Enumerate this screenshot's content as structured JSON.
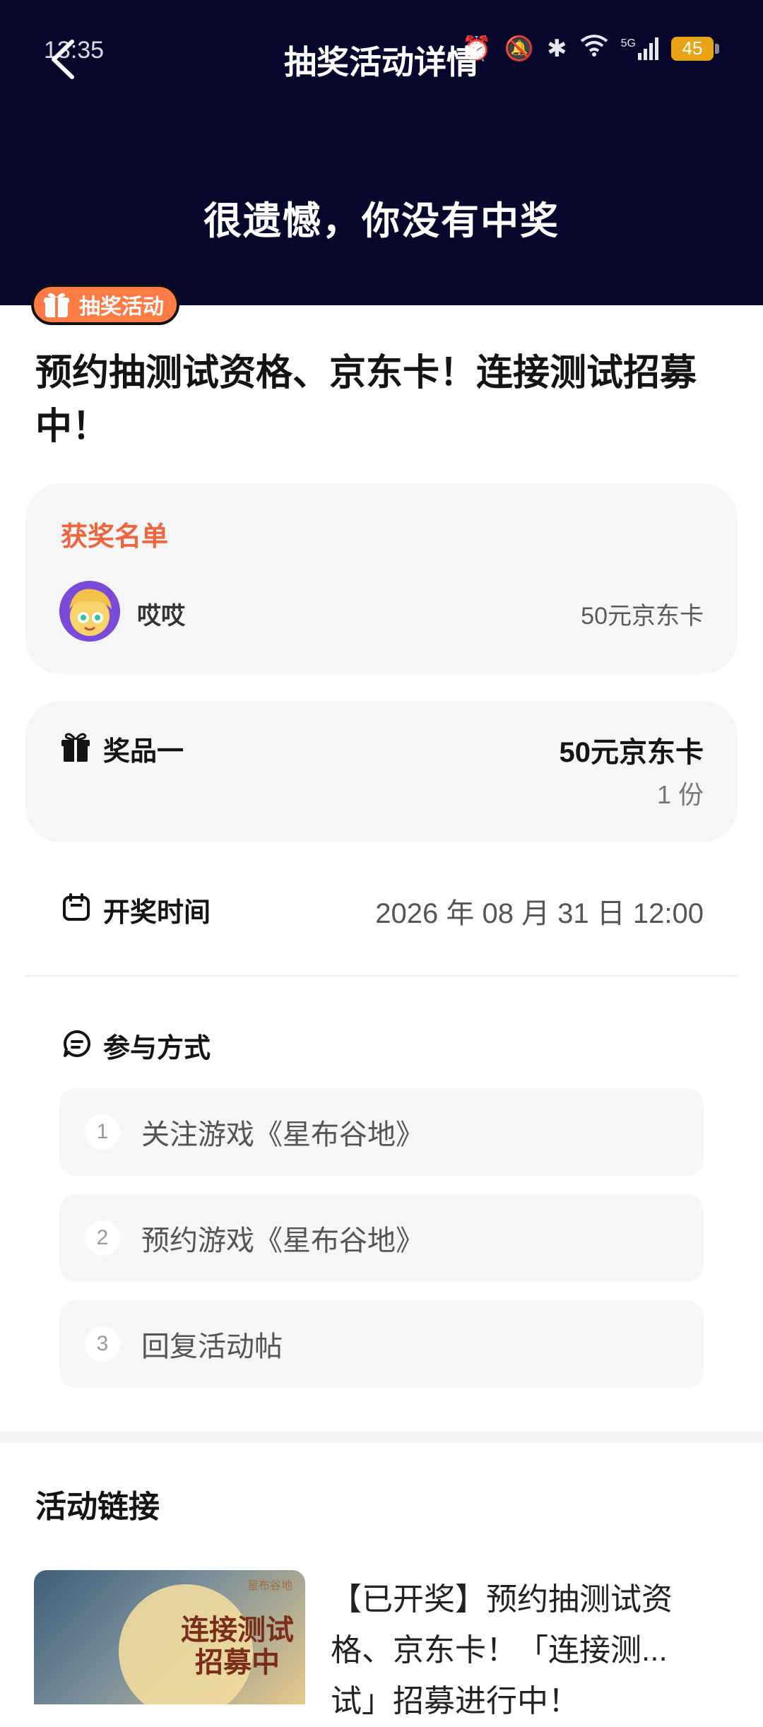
{
  "status_bar": {
    "time": "13:35",
    "network": "5G",
    "battery": "45"
  },
  "header": {
    "title": "抽奖活动详情",
    "result": "很遗憾，你没有中奖"
  },
  "activity": {
    "tag": "抽奖活动",
    "headline": "预约抽测试资格、京东卡！连接测试招募中！"
  },
  "winners": {
    "title": "获奖名单",
    "list": [
      {
        "name": "哎哎",
        "prize": "50元京东卡"
      }
    ]
  },
  "prize": {
    "label": "奖品一",
    "name": "50元京东卡",
    "quantity": "1 份"
  },
  "draw": {
    "label": "开奖时间",
    "time": "2026 年 08 月 31 日 12:00"
  },
  "participation": {
    "label": "参与方式",
    "steps": [
      {
        "num": "1",
        "text": "关注游戏《星布谷地》"
      },
      {
        "num": "2",
        "text": "预约游戏《星布谷地》"
      },
      {
        "num": "3",
        "text": "回复活动帖"
      }
    ]
  },
  "links": {
    "title": "活动链接",
    "thumb_text": "连接测试招募中",
    "thumb_brand": "星布谷地",
    "text": "【已开奖】预约抽测试资格、京东卡！「连接测...试」招募进行中！"
  },
  "colors": {
    "header_bg": "#07062b",
    "accent": "#f0653e",
    "tag": "#ff7a45"
  }
}
